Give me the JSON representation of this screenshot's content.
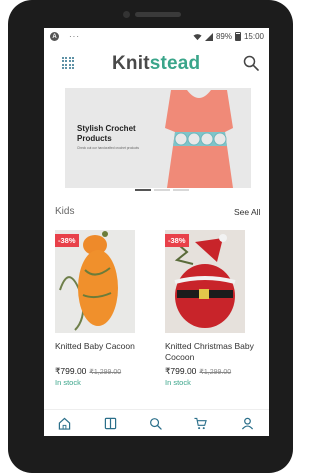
{
  "status_bar": {
    "left_badge": "A",
    "left_dots": "···",
    "battery": "89%",
    "time": "15:00"
  },
  "header": {
    "logo_part1": "Knit",
    "logo_part2": "stead",
    "menu_icon": "grid-icon",
    "search_icon": "search-icon"
  },
  "banner": {
    "title": "Stylish Crochet Products",
    "subtitle": "Check out our handcrafted crochet products",
    "active_slide": 1,
    "slide_count": 3
  },
  "section": {
    "title": "Kids",
    "see_all": "See All"
  },
  "products": [
    {
      "name": "Knitted Baby Cacoon",
      "discount": "-38%",
      "price": "₹799.00",
      "mrp": "₹1,299.00",
      "stock": "In stock"
    },
    {
      "name": "Knitted Christmas Baby Cocoon",
      "discount": "-38%",
      "price": "₹799.00",
      "mrp": "₹1,299.00",
      "stock": "In stock"
    }
  ],
  "bottom_nav": {
    "items": [
      "home-icon",
      "catalog-icon",
      "search-icon",
      "cart-icon",
      "account-icon"
    ]
  },
  "colors": {
    "accent": "#3aa58a",
    "discount": "#e8414a",
    "icon_blue": "#2b6f8a"
  }
}
